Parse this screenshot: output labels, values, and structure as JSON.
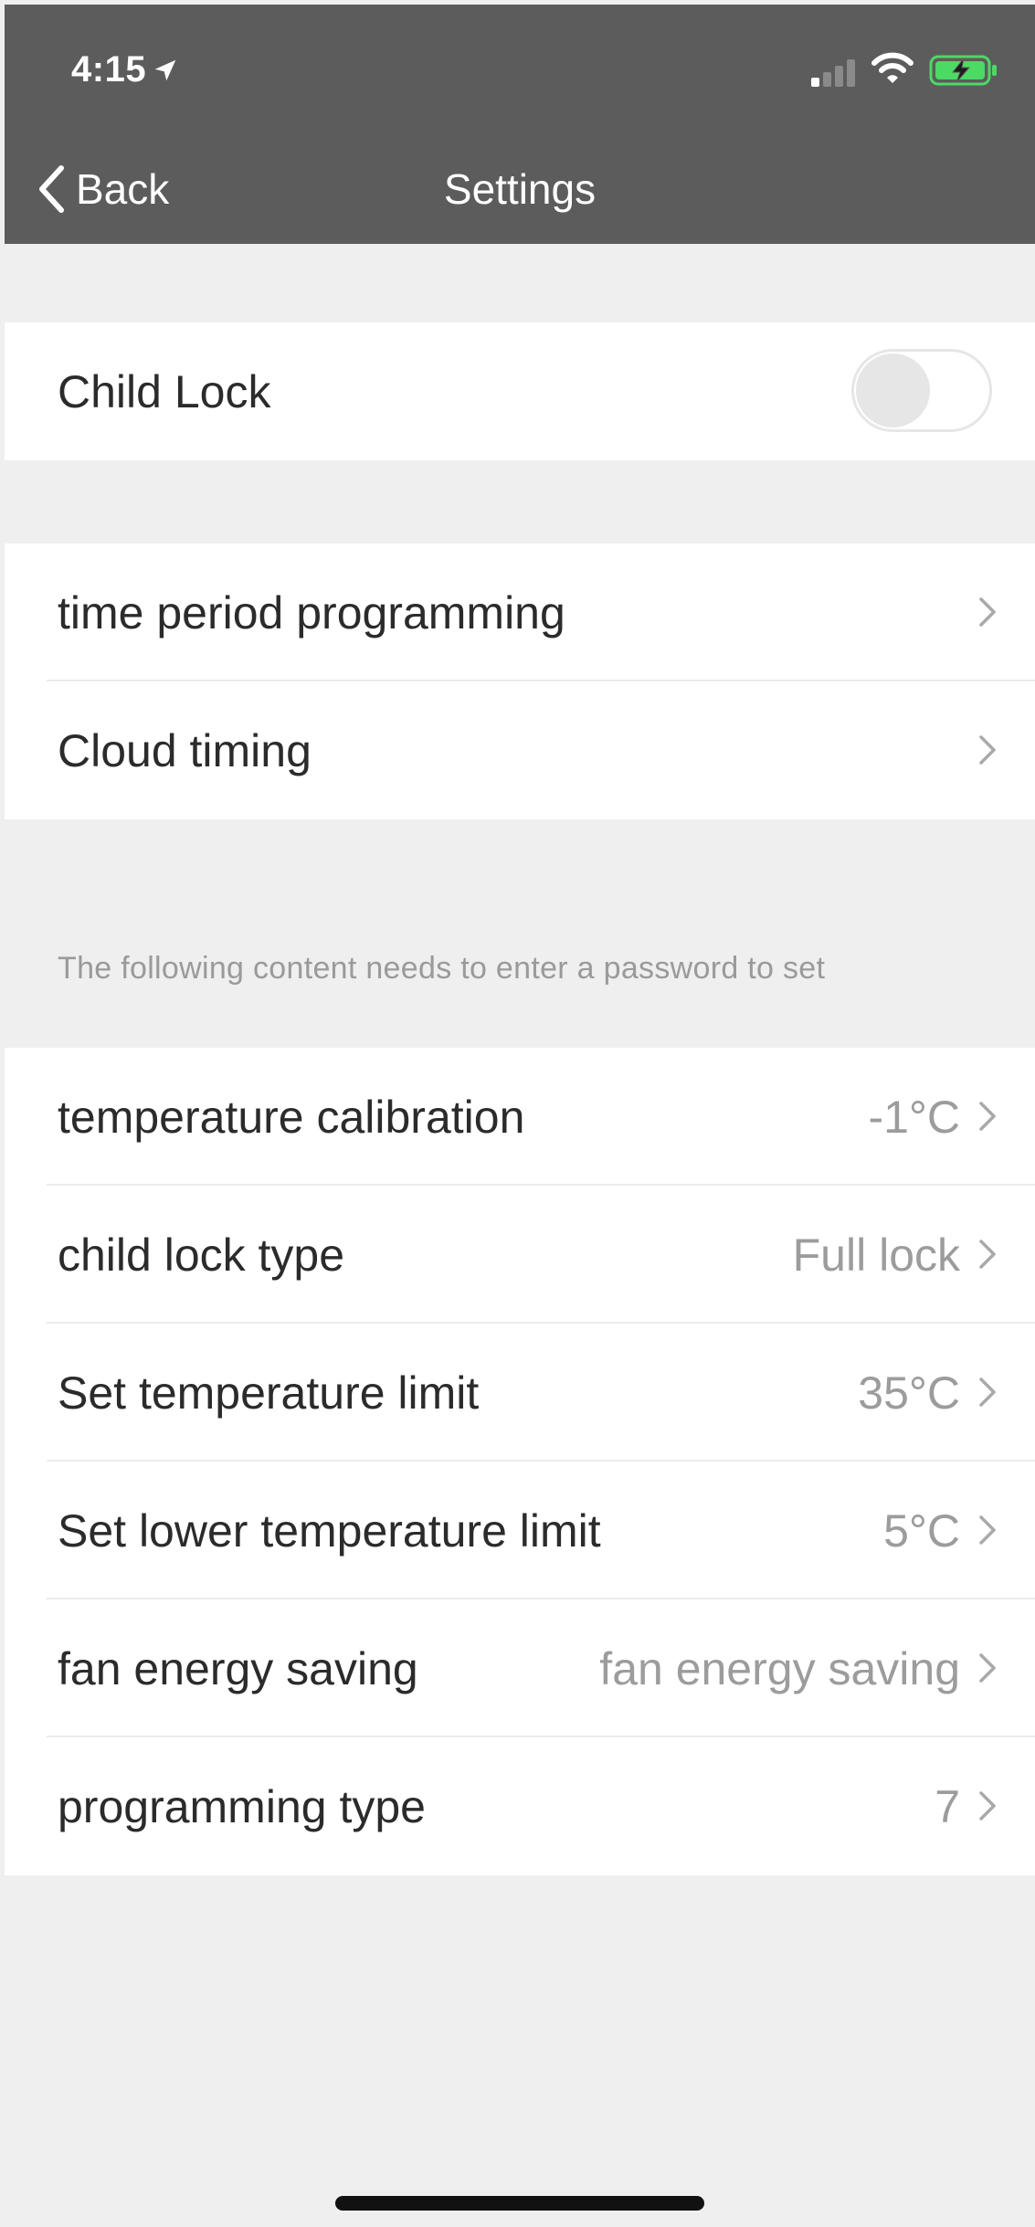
{
  "status_bar": {
    "time": "4:15",
    "location_icon": "location-arrow-icon",
    "signal_icon": "cellular-signal-icon",
    "wifi_icon": "wifi-icon",
    "battery_icon": "battery-charging-icon"
  },
  "nav": {
    "back_label": "Back",
    "title": "Settings"
  },
  "child_lock": {
    "label": "Child Lock",
    "enabled": false
  },
  "programming": [
    {
      "label": "time period programming"
    },
    {
      "label": "Cloud timing"
    }
  ],
  "password_section": {
    "note": "The following content needs to enter a password to set",
    "rows": [
      {
        "label": "temperature calibration",
        "value": "-1°C"
      },
      {
        "label": "child lock type",
        "value": "Full lock"
      },
      {
        "label": "Set temperature limit",
        "value": "35°C"
      },
      {
        "label": "Set lower temperature limit",
        "value": "5°C"
      },
      {
        "label": "fan energy saving",
        "value": "fan energy saving"
      },
      {
        "label": "programming type",
        "value": "7"
      }
    ]
  },
  "colors": {
    "header_bg": "#5c5c5c",
    "page_bg": "#efefef",
    "battery_green": "#4cd964",
    "value_gray": "#9c9c9c"
  }
}
